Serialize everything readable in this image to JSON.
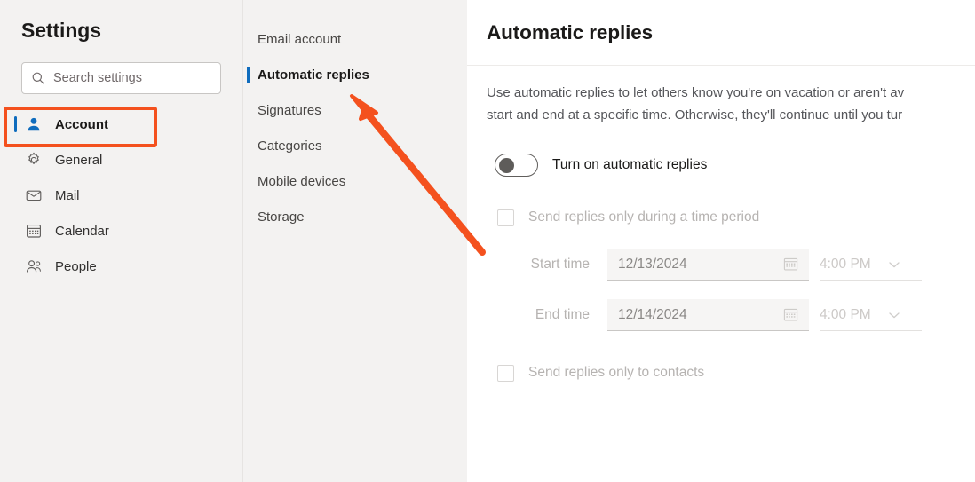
{
  "sidebar": {
    "title": "Settings",
    "search": {
      "placeholder": "Search settings",
      "icon": "search-icon"
    },
    "items": [
      {
        "label": "Account",
        "icon": "person-icon",
        "active": true
      },
      {
        "label": "General",
        "icon": "gear-icon",
        "active": false
      },
      {
        "label": "Mail",
        "icon": "envelope-icon",
        "active": false
      },
      {
        "label": "Calendar",
        "icon": "calendar-icon",
        "active": false
      },
      {
        "label": "People",
        "icon": "people-icon",
        "active": false
      }
    ]
  },
  "subnav": {
    "items": [
      {
        "label": "Email account",
        "active": false
      },
      {
        "label": "Automatic replies",
        "active": true
      },
      {
        "label": "Signatures",
        "active": false
      },
      {
        "label": "Categories",
        "active": false
      },
      {
        "label": "Mobile devices",
        "active": false
      },
      {
        "label": "Storage",
        "active": false
      }
    ]
  },
  "main": {
    "title": "Automatic replies",
    "description": "Use automatic replies to let others know you're on vacation or aren't av\nstart and end at a specific time. Otherwise, they'll continue until you tur",
    "toggle": {
      "label": "Turn on automatic replies",
      "state": "off"
    },
    "time_period": {
      "checkbox_label": "Send replies only during a time period",
      "checked": false,
      "rows": [
        {
          "label": "Start time",
          "date": "12/13/2024",
          "time": "4:00 PM",
          "date_icon": "calendar-icon",
          "time_icon": "chevron-down-icon"
        },
        {
          "label": "End time",
          "date": "12/14/2024",
          "time": "4:00 PM",
          "date_icon": "calendar-icon",
          "time_icon": "chevron-down-icon"
        }
      ]
    },
    "contacts": {
      "checkbox_label": "Send replies only to contacts",
      "checked": false
    }
  },
  "annotations": {
    "highlight_color": "#f4511e",
    "arrow_color": "#f4511e",
    "accent_color": "#0f6cbd"
  }
}
